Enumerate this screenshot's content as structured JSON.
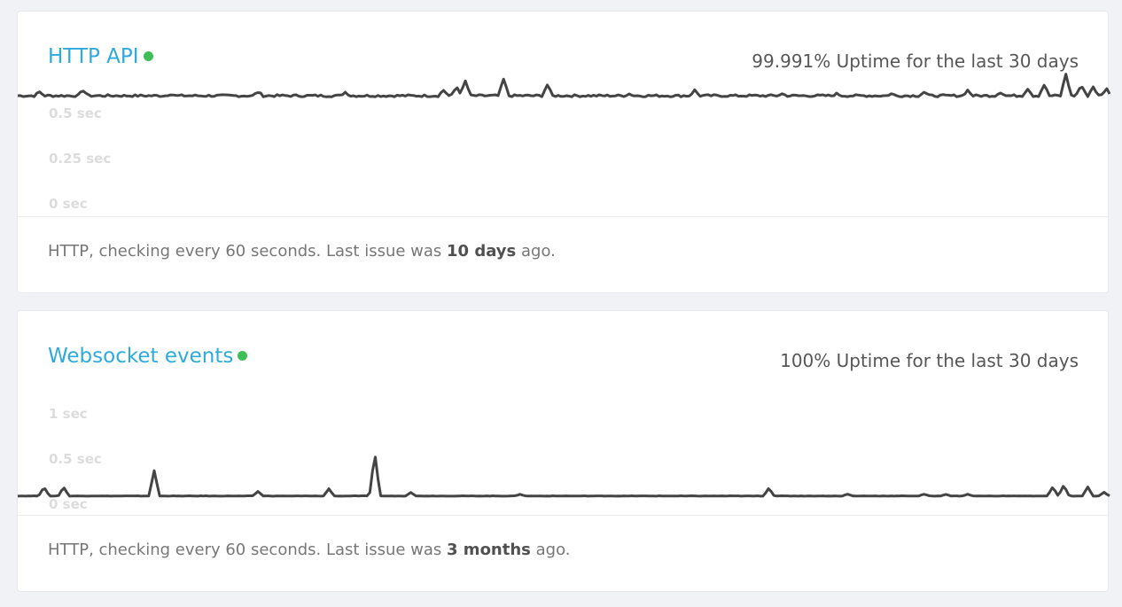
{
  "colors": {
    "title": "#2eaadc",
    "status_dot": "#3ebf57",
    "chart_line": "#444444",
    "axis_label": "#dcdcdc",
    "text": "#777777"
  },
  "monitors": [
    {
      "name": "HTTP API",
      "status_icon": "green-status-dot",
      "uptime": "99.991% Uptime for the last 30 days",
      "axis_labels": [
        "0.5 sec",
        "0.25 sec",
        "0 sec"
      ],
      "footer_prefix": "HTTP, checking every 60 seconds. Last issue was ",
      "footer_highlight": "10 days",
      "footer_suffix": " ago.",
      "chart_data": {
        "type": "line",
        "ylabel": "",
        "ylim": [
          0,
          0.5
        ],
        "baseline": 0.495,
        "spikes": [
          [
            0.02,
            0.02
          ],
          [
            0.06,
            0.03
          ],
          [
            0.14,
            0.01
          ],
          [
            0.22,
            0.02
          ],
          [
            0.3,
            0.02
          ],
          [
            0.39,
            0.03
          ],
          [
            0.402,
            0.05
          ],
          [
            0.41,
            0.08
          ],
          [
            0.445,
            0.09
          ],
          [
            0.485,
            0.06
          ],
          [
            0.56,
            0.01
          ],
          [
            0.62,
            0.03
          ],
          [
            0.7,
            0.01
          ],
          [
            0.75,
            0.01
          ],
          [
            0.8,
            0.01
          ],
          [
            0.83,
            0.02
          ],
          [
            0.87,
            0.03
          ],
          [
            0.9,
            0.02
          ],
          [
            0.925,
            0.04
          ],
          [
            0.94,
            0.06
          ],
          [
            0.96,
            0.12
          ],
          [
            0.974,
            0.06
          ],
          [
            0.985,
            0.05
          ],
          [
            0.997,
            0.04
          ]
        ]
      }
    },
    {
      "name": "Websocket events",
      "status_icon": "green-status-dot",
      "uptime": "100% Uptime for the last 30 days",
      "axis_labels": [
        "1 sec",
        "0.5 sec",
        "0 sec"
      ],
      "footer_prefix": "HTTP, checking every 60 seconds. Last issue was ",
      "footer_highlight": "3 months",
      "footer_suffix": " ago.",
      "chart_data": {
        "type": "line",
        "ylabel": "",
        "ylim": [
          0,
          1
        ],
        "baseline": 0.14,
        "spikes": [
          [
            0.024,
            0.1
          ],
          [
            0.042,
            0.1
          ],
          [
            0.125,
            0.28
          ],
          [
            0.22,
            0.05
          ],
          [
            0.285,
            0.08
          ],
          [
            0.327,
            0.48
          ],
          [
            0.36,
            0.04
          ],
          [
            0.46,
            0.02
          ],
          [
            0.688,
            0.09
          ],
          [
            0.76,
            0.02
          ],
          [
            0.83,
            0.02
          ],
          [
            0.85,
            0.02
          ],
          [
            0.87,
            0.02
          ],
          [
            0.948,
            0.1
          ],
          [
            0.958,
            0.12
          ],
          [
            0.98,
            0.1
          ],
          [
            0.995,
            0.04
          ]
        ]
      }
    }
  ]
}
